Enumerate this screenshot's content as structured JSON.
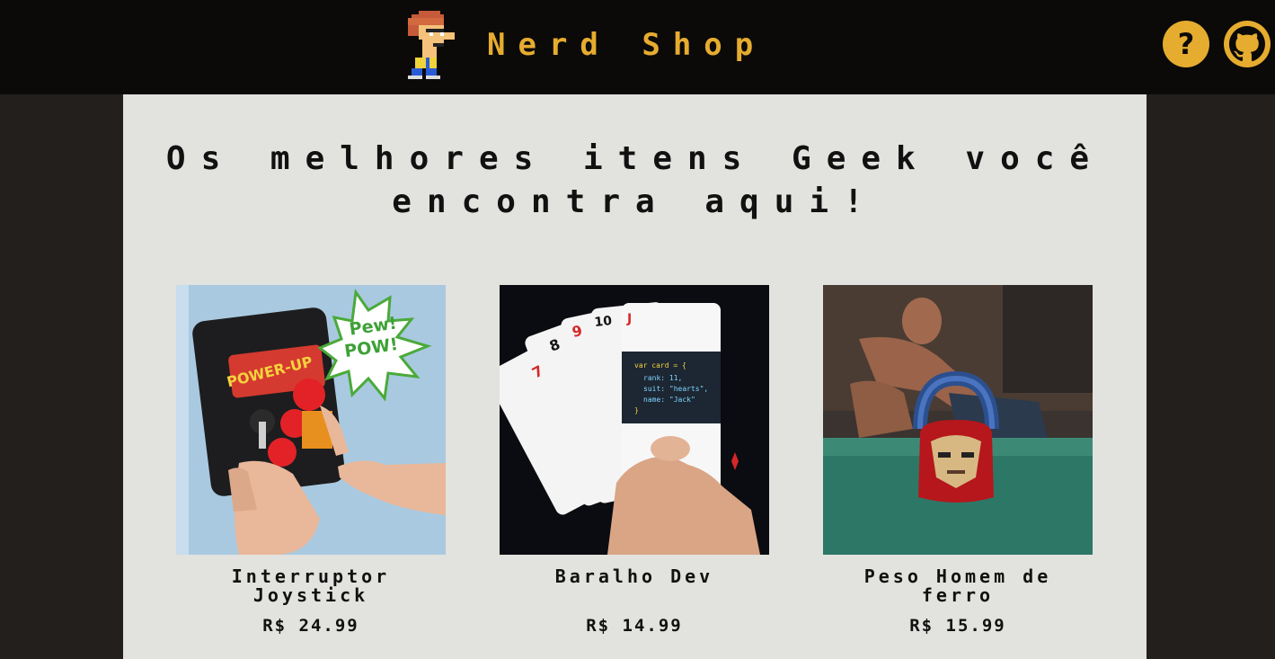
{
  "colors": {
    "accent": "#e6ac2f",
    "header_bg": "#0b0a09",
    "page_bg": "#231f1c",
    "panel_bg": "#e2e2de"
  },
  "header": {
    "brand": "Nerd Shop",
    "logo_icon": "pixel-nerd-character-icon",
    "help_icon": "question-mark-icon",
    "github_icon": "github-icon",
    "help_glyph": "?"
  },
  "main": {
    "headline": "Os melhores itens Geek você encontra aqui!",
    "products": [
      {
        "name": "Interruptor Joystick",
        "price": "R$ 24.99",
        "image": "arcade-joystick-switch"
      },
      {
        "name": "Baralho Dev",
        "price": "R$ 14.99",
        "image": "developer-playing-cards"
      },
      {
        "name": "Peso Homem de ferro",
        "price": "R$ 15.99",
        "image": "iron-man-kettlebell"
      }
    ]
  }
}
